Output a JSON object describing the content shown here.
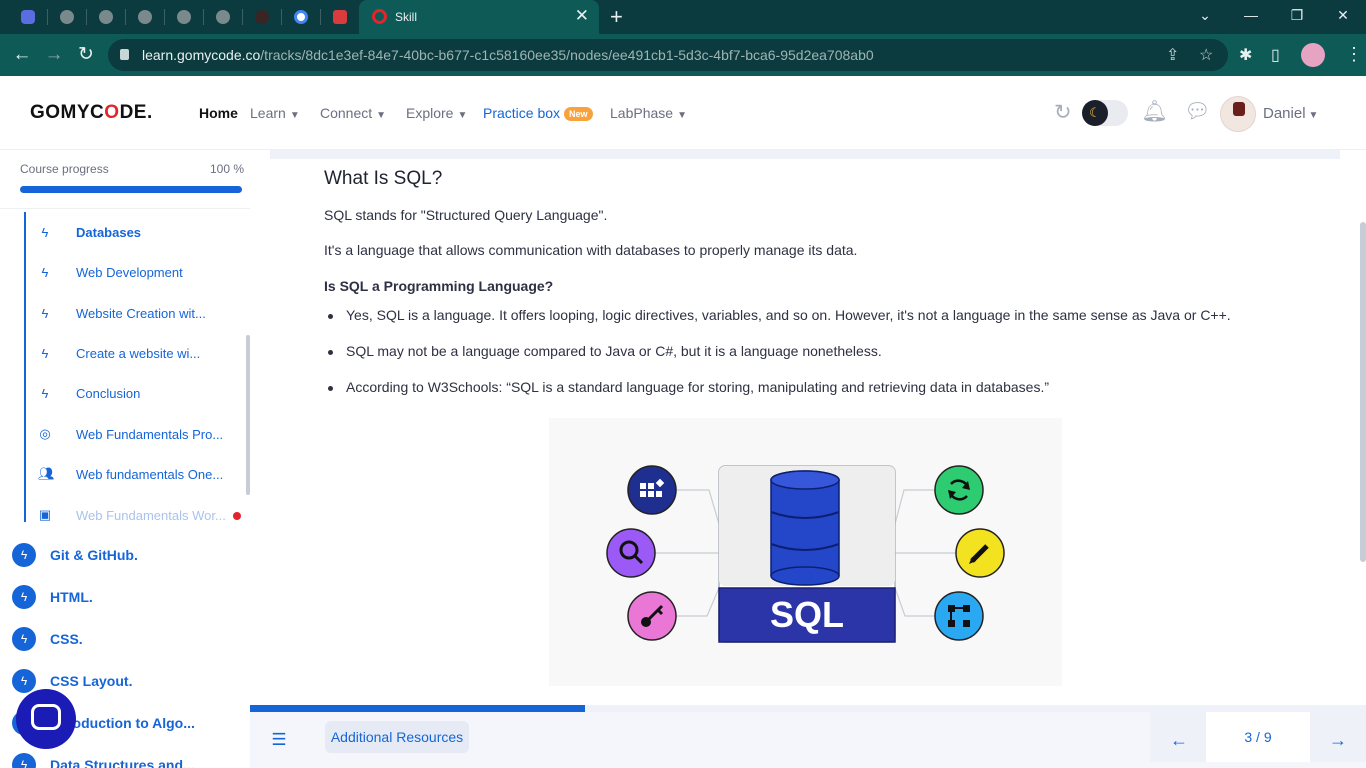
{
  "browser": {
    "active_tab_title": "Skill",
    "url_host": "learn.gomycode.co",
    "url_path": "/tracks/8dc1e3ef-84e7-40bc-b677-c1c58160ee35/nodes/ee491cb1-5d3c-4bf7-bca6-95d2ea708ab0",
    "close_glyph": "✕",
    "new_tab_glyph": "+"
  },
  "header": {
    "logo_prefix": "GOMYC",
    "logo_o": "O",
    "logo_suffix": "DE.",
    "nav": {
      "home": "Home",
      "learn": "Learn",
      "connect": "Connect",
      "explore": "Explore",
      "practice_box": "Practice box",
      "new_badge": "New",
      "labphase": "LabPhase"
    },
    "username": "Daniel"
  },
  "sidebar": {
    "progress_label": "Course progress",
    "progress_value": "100 %",
    "progress_fraction": 1.0,
    "sub_items": [
      {
        "label": "Databases",
        "icon": "lightning-icon",
        "bold": true
      },
      {
        "label": "Web Development",
        "icon": "lightning-icon"
      },
      {
        "label": "Website Creation wit...",
        "icon": "lightning-icon"
      },
      {
        "label": "Create a website wi...",
        "icon": "lightning-icon"
      },
      {
        "label": "Conclusion",
        "icon": "lightning-icon"
      },
      {
        "label": "Web Fundamentals Pro...",
        "icon": "target-icon"
      },
      {
        "label": "Web fundamentals One...",
        "icon": "people-icon"
      },
      {
        "label": "Web Fundamentals Wor...",
        "icon": "workshop-icon",
        "faded": true,
        "unread": true
      }
    ],
    "chapters": [
      {
        "label": "Git & GitHub."
      },
      {
        "label": "HTML."
      },
      {
        "label": "CSS."
      },
      {
        "label": "CSS Layout."
      },
      {
        "label": "Introduction to Algo..."
      },
      {
        "label": "Data Structures and..."
      }
    ]
  },
  "content": {
    "title": "What Is SQL?",
    "paragraph_1": "SQL stands for \"Structured Query Language\".",
    "paragraph_2": "It's a language that allows communication with databases to properly manage its data.",
    "subheading": "Is SQL a Programming Language?",
    "bullets": [
      "Yes, SQL is a language. It offers looping, logic directives, variables, and so on. However, it's not a language in the same sense as Java or C++.",
      "SQL may not be a language compared to Java or C#, but it is a language nonetheless.",
      "According to W3Schools: “SQL is a standard language for storing, manipulating and retrieving data in databases.”"
    ],
    "figure_label": "SQL"
  },
  "footer": {
    "lesson_progress_fraction": 0.3,
    "resources_label": "Additional Resources",
    "pager": "3 / 9",
    "prev_glyph": "←",
    "next_glyph": "→"
  },
  "colors": {
    "accent": "#1565d8",
    "brand_red": "#e3242b",
    "chrome_dark": "#0b3b3f",
    "chrome_toolbar": "#0e5a57",
    "new_badge": "#f8a23b"
  }
}
